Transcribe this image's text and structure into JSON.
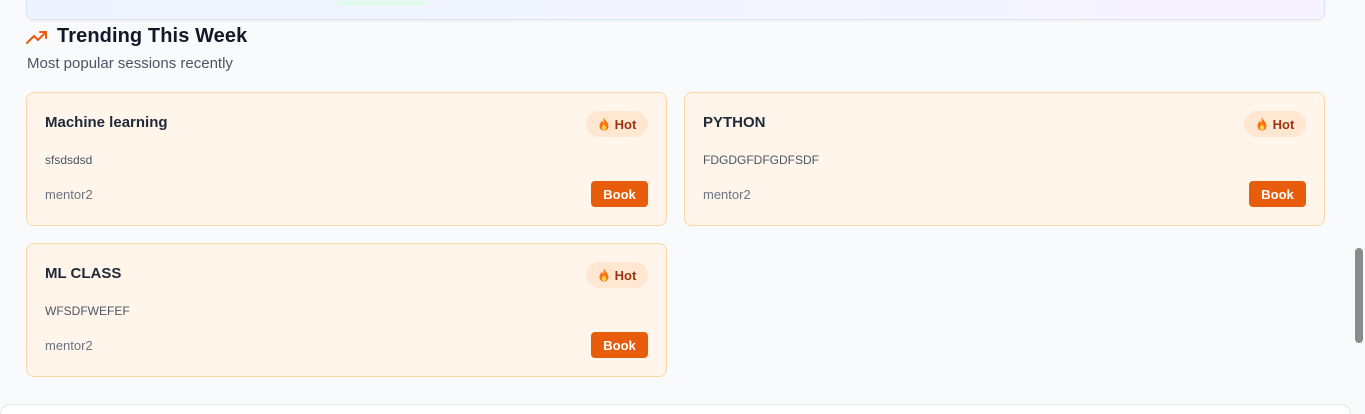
{
  "section": {
    "title": "Trending This Week",
    "subtitle": "Most popular sessions recently"
  },
  "icons": {
    "trend": "trending-up-icon",
    "flame": "flame-icon"
  },
  "colors": {
    "accent": "#e85d0c",
    "card_bg": "#fff5eb",
    "card_border": "#fbd7a8",
    "badge_bg": "#ffe7d1"
  },
  "sessions": [
    {
      "title": "Machine learning",
      "description": "sfsdsdsd",
      "mentor": "mentor2",
      "badge": "Hot",
      "action": "Book"
    },
    {
      "title": "PYTHON",
      "description": "FDGDGFDFGDFSDF",
      "mentor": "mentor2",
      "badge": "Hot",
      "action": "Book"
    },
    {
      "title": "ML CLASS",
      "description": "WFSDFWEFEF",
      "mentor": "mentor2",
      "badge": "Hot",
      "action": "Book"
    }
  ]
}
